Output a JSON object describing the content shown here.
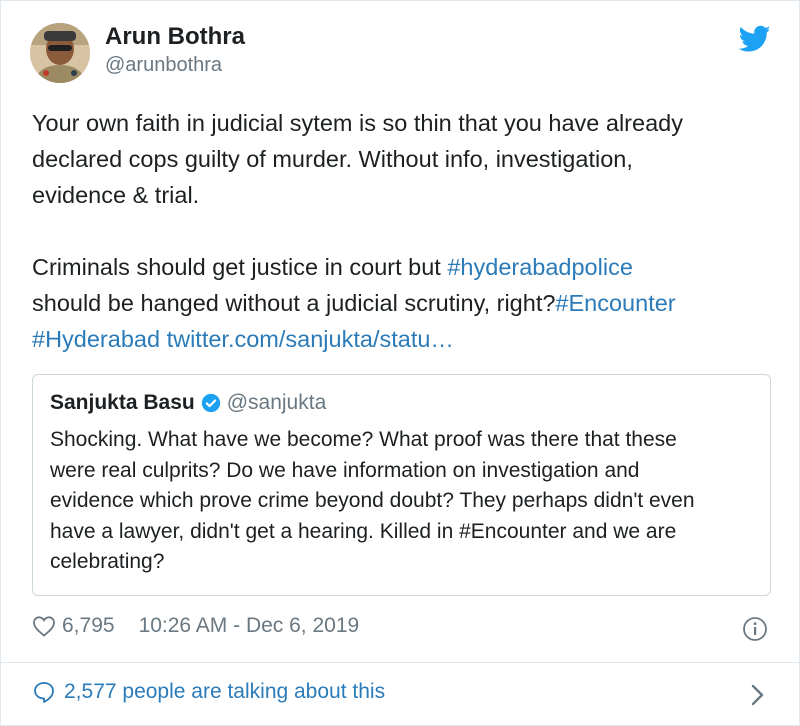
{
  "author": {
    "name": "Arun Bothra",
    "handle": "@arunbothra"
  },
  "tweet": {
    "lines": [
      "Your own faith in judicial sytem is so thin that you have already",
      "declared cops guilty of murder. Without info, investigation,",
      "evidence & trial."
    ],
    "line4_text": "Criminals should get justice in court but ",
    "hashtag_hyderabadpolice": "#hyderabadpolice",
    "line5_text": "should be hanged without a judicial scrutiny, right?",
    "hashtag_encounter": "#Encounter",
    "hashtag_hyderabad": "#Hyderabad",
    "link": "twitter.com/sanjukta/statu…"
  },
  "quoted_tweet": {
    "name": "Sanjukta Basu",
    "handle": "@sanjukta",
    "lines": [
      "Shocking. What have we become? What proof was there that these",
      "were real culprits? Do we have information on investigation and",
      "evidence which prove crime beyond doubt? They perhaps didn't even",
      "have a lawyer, didn't get a hearing. Killed in #Encounter and we are",
      "celebrating?"
    ]
  },
  "meta": {
    "likes": "6,795",
    "timestamp": "10:26 AM - Dec 6, 2019"
  },
  "footer": {
    "talking": "2,577 people are talking about this"
  },
  "colors": {
    "link": "#2b7bb9",
    "twitter_blue": "#1da1f2",
    "muted": "#697882"
  },
  "icons": [
    "twitter-bird-icon",
    "verified-badge-icon",
    "heart-icon",
    "info-icon",
    "comment-bubble-icon",
    "chevron-right-icon"
  ]
}
